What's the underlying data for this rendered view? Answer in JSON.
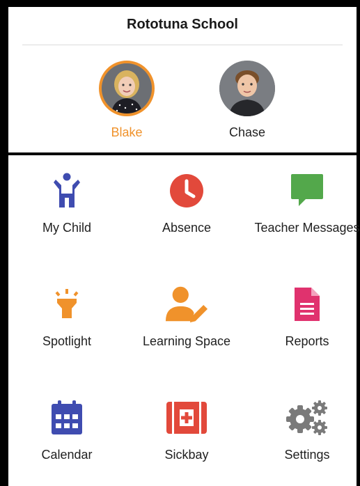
{
  "header": {
    "school_name": "Rototuna School"
  },
  "children": [
    {
      "name": "Blake",
      "selected": true
    },
    {
      "name": "Chase",
      "selected": false
    }
  ],
  "menu": [
    {
      "label": "My Child",
      "icon": "child-icon",
      "color": "#3f4cb0"
    },
    {
      "label": "Absence",
      "icon": "clock-icon",
      "color": "#e2493b"
    },
    {
      "label": "Teacher Messages",
      "icon": "message-icon",
      "color": "#53a84b"
    },
    {
      "label": "Spotlight",
      "icon": "spotlight-icon",
      "color": "#f0922b"
    },
    {
      "label": "Learning Space",
      "icon": "person-pencil-icon",
      "color": "#f0922b"
    },
    {
      "label": "Reports",
      "icon": "document-icon",
      "color": "#e0326e"
    },
    {
      "label": "Calendar",
      "icon": "calendar-icon",
      "color": "#3f4cb0"
    },
    {
      "label": "Sickbay",
      "icon": "first-aid-icon",
      "color": "#e2493b"
    },
    {
      "label": "Settings",
      "icon": "gears-icon",
      "color": "#7a7a7a"
    }
  ],
  "colors": {
    "accent": "#f0922b"
  }
}
